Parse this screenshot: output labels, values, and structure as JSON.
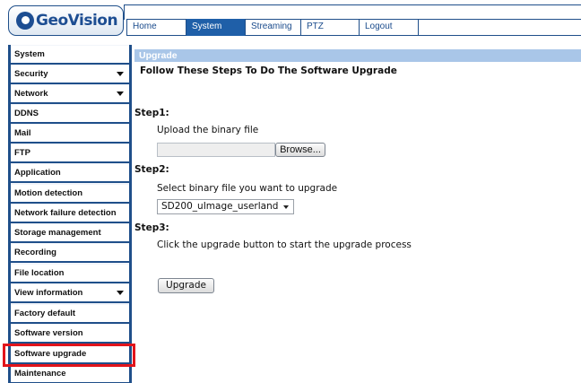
{
  "logo": {
    "text": "GeoVision"
  },
  "nav": {
    "tabs": [
      "Home",
      "System",
      "Streaming",
      "PTZ",
      "Logout"
    ],
    "active": "System"
  },
  "sidebar": {
    "items": [
      {
        "label": "System",
        "expandable": false
      },
      {
        "label": "Security",
        "expandable": true
      },
      {
        "label": "Network",
        "expandable": true
      },
      {
        "label": "DDNS",
        "expandable": false
      },
      {
        "label": "Mail",
        "expandable": false
      },
      {
        "label": "FTP",
        "expandable": false
      },
      {
        "label": "Application",
        "expandable": false
      },
      {
        "label": "Motion detection",
        "expandable": false
      },
      {
        "label": "Network failure detection",
        "expandable": false
      },
      {
        "label": "Storage management",
        "expandable": false
      },
      {
        "label": "Recording",
        "expandable": false
      },
      {
        "label": "File location",
        "expandable": false
      },
      {
        "label": "View information",
        "expandable": true
      },
      {
        "label": "Factory default",
        "expandable": false
      },
      {
        "label": "Software version",
        "expandable": false
      },
      {
        "label": "Software upgrade",
        "expandable": false,
        "highlighted": true
      },
      {
        "label": "Maintenance",
        "expandable": false
      }
    ]
  },
  "content": {
    "header": "Upgrade",
    "title": "Follow These Steps To Do The Software Upgrade",
    "step1": {
      "label": "Step1:",
      "desc": "Upload the binary file",
      "file_value": "",
      "browse_label": "Browse..."
    },
    "step2": {
      "label": "Step2:",
      "desc": "Select binary file you want to upgrade",
      "selected": "SD200_uImage_userland"
    },
    "step3": {
      "label": "Step3:",
      "desc": "Click the upgrade button to start the upgrade process"
    },
    "upgrade_label": "Upgrade"
  },
  "colors": {
    "nav_border": "#1f4f8a",
    "active_tab": "#1f5fa8",
    "header_bar": "#a9c6e8",
    "highlight": "#e2141b"
  }
}
